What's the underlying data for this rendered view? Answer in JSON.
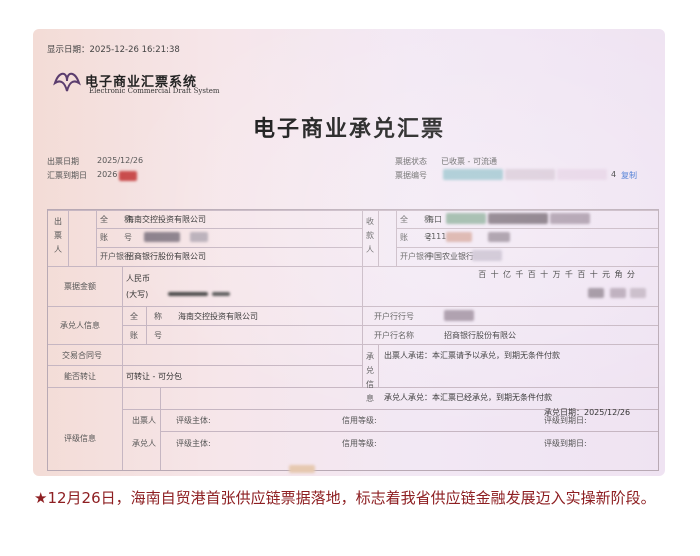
{
  "header": {
    "display_date": "显示日期：2025-12-26 16:21:38",
    "logo_cn": "电子商业汇票系统",
    "logo_en": "Electronic Commercial Draft System",
    "title": "电子商业承兑汇票"
  },
  "meta": {
    "issue_date_label": "出票日期",
    "issue_date": "2025/12/26",
    "due_date_label": "汇票到期日",
    "due_date": "2026",
    "status_label": "票据状态",
    "status": "已收票 - 可流通",
    "bill_no_label": "票据编号",
    "bill_no_suffix": "4",
    "copy_link": "复制"
  },
  "drawer": {
    "section": "出票人",
    "name_label": "全　　称",
    "name": "海南交控投资有限公司",
    "account_label": "账　　号",
    "bank_label": "开户银行",
    "bank": "招商银行股份有限公司"
  },
  "payee": {
    "section": "收款人",
    "name_label": "全　　称",
    "name": "海口",
    "account_label": "账　　号",
    "account": "2111",
    "bank_label": "开户银行",
    "bank": "中国农业银行"
  },
  "amount": {
    "label": "票据金额",
    "currency": "人民币",
    "uppercase": "(大写)",
    "digits": [
      "百",
      "十",
      "亿",
      "千",
      "百",
      "十",
      "万",
      "千",
      "百",
      "十",
      "元",
      "角",
      "分"
    ]
  },
  "acceptor": {
    "label": "承兑人信息",
    "name_label": "全　　称",
    "name": "海南交控投资有限公司",
    "account_label": "账　　号",
    "bank_no_label": "开户行行号",
    "bank_name_label": "开户行名称",
    "bank_name": "招商银行股份有限公"
  },
  "contract": {
    "label": "交易合同号",
    "guarantee_section": "承兑信息",
    "drawer_promise": "出票人承诺：本汇票请予以承兑，到期无条件付款",
    "acceptor_promise": "承兑人承兑：本汇票已经承兑，到期无条件付款",
    "accept_date": "承兑日期：2025/12/26"
  },
  "transfer": {
    "label": "能否转让",
    "value": "可转让 - 可分包"
  },
  "rating": {
    "label": "评级信息",
    "rows": [
      {
        "party": "出票人",
        "subject": "评级主体:",
        "grade": "信用等级:",
        "due": "评级到期日:"
      },
      {
        "party": "承兑人",
        "subject": "评级主体:",
        "grade": "信用等级:",
        "due": "评级到期日:"
      }
    ]
  },
  "caption": "★12月26日，海南自贸港首张供应链票据落地，标志着我省供应链金融发展迈入实操新阶段。"
}
